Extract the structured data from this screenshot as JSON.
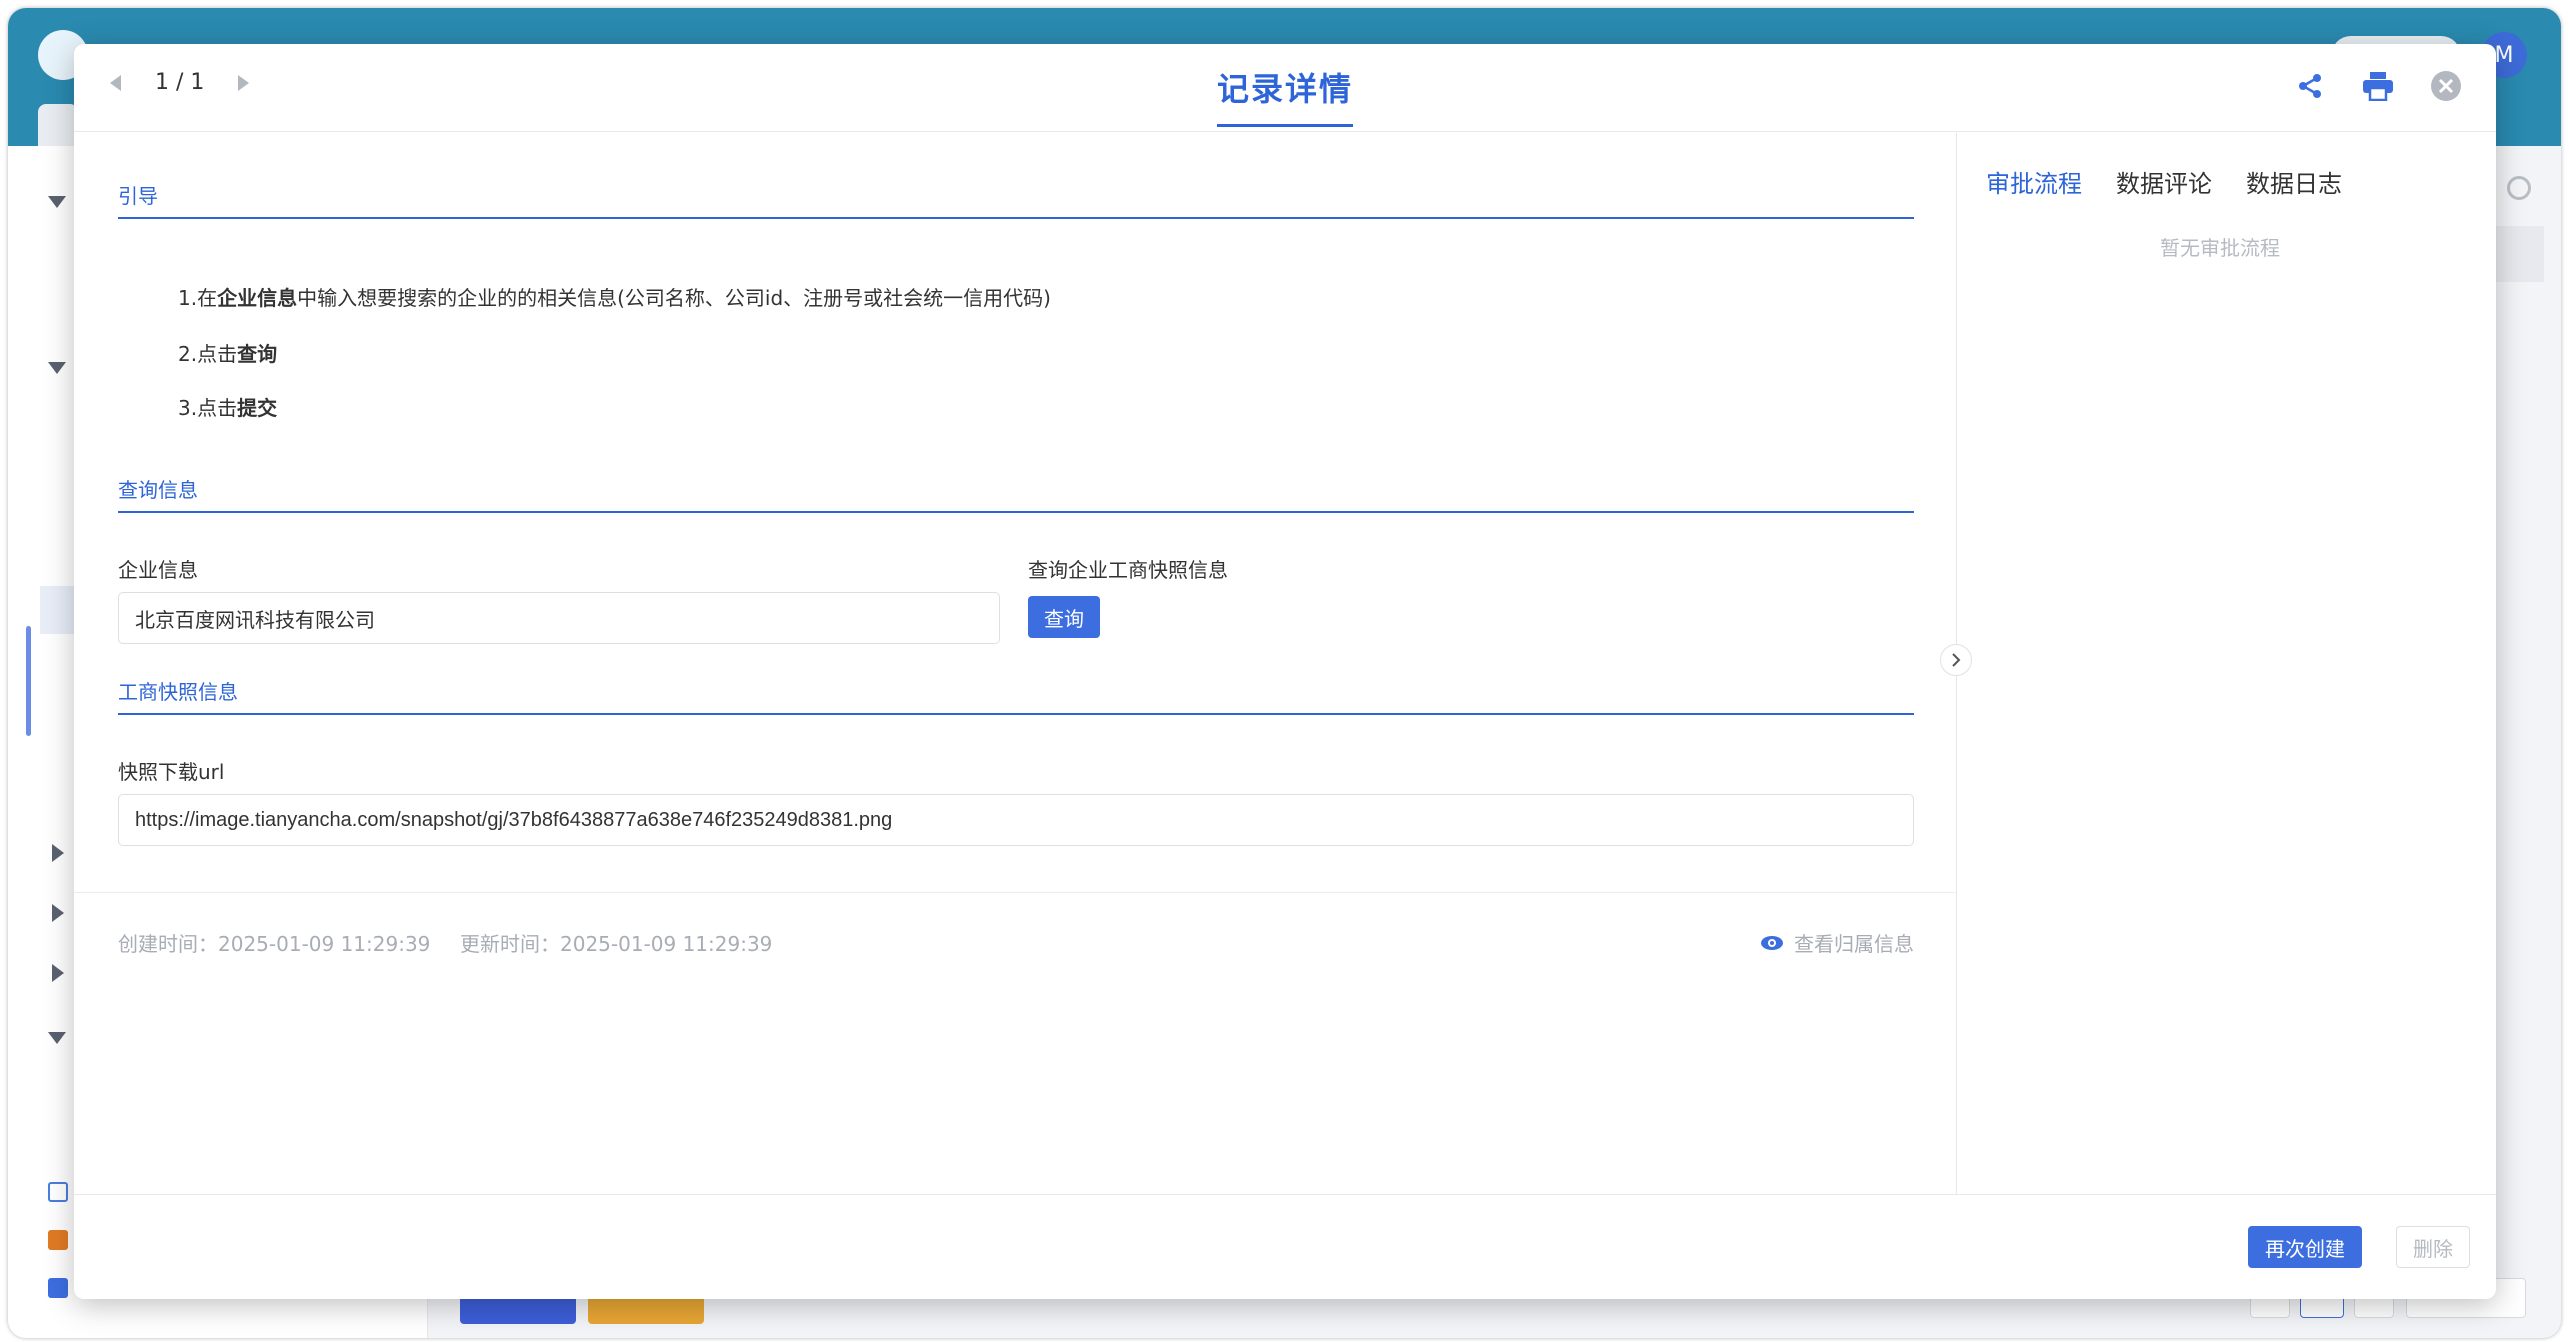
{
  "colors": {
    "accent": "#2d65d8",
    "primary_button": "#3d6ee0",
    "muted_text": "#a8adb5"
  },
  "modal": {
    "title": "记录详情",
    "pager": {
      "current": "1 / 1"
    },
    "header_icons": [
      "share-icon",
      "print-icon",
      "close-icon"
    ]
  },
  "sections": {
    "guide": {
      "title": "引导",
      "step1": {
        "prefix": "1.在",
        "bold": "企业信息",
        "suffix": "中输入想要搜索的企业的的相关信息(公司名称、公司id、注册号或社会统一信用代码)"
      },
      "step2": {
        "prefix": "2.点击",
        "bold": "查询"
      },
      "step3": {
        "prefix": "3.点击",
        "bold": "提交"
      }
    },
    "query": {
      "title": "查询信息",
      "company_label": "企业信息",
      "company_value": "北京百度网讯科技有限公司",
      "snapshot_query_label": "查询企业工商快照信息",
      "query_button": "查询"
    },
    "snapshot": {
      "title": "工商快照信息",
      "url_label": "快照下载url",
      "url_value": "https://image.tianyancha.com/snapshot/gj/37b8f6438877a638e746f235249d8381.png"
    }
  },
  "meta": {
    "created": "创建时间：2025-01-09 11:29:39",
    "updated": "更新时间：2025-01-09 11:29:39",
    "owner_link": "查看归属信息"
  },
  "right_panel": {
    "tabs": [
      "审批流程",
      "数据评论",
      "数据日志"
    ],
    "empty_text": "暂无审批流程"
  },
  "footer": {
    "recreate_button": "再次创建",
    "delete_button": "删除"
  },
  "background": {
    "avatar_letter": "M"
  }
}
